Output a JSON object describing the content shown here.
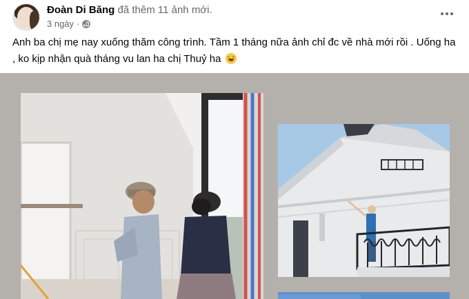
{
  "post": {
    "author": "Đoàn Di Băng",
    "action": "đã thêm 11 ảnh mới.",
    "time": "3 ngày",
    "separator": "·",
    "privacy_icon": "globe-icon",
    "more_icon": "more-horizontal-icon",
    "text": "Anh ba chị mẹ nay xuống thăm công trình. Tầm 1 tháng nữa ảnh chỉ đc về nhà mới rồi . Uống ha , ko kịp nhận quà tháng vu lan ha chị Thuỷ ha",
    "emoji": "grinning-face-emoji"
  },
  "colors": {
    "gallery_background": "#b4b0ac",
    "secondary_text": "#65676b"
  }
}
